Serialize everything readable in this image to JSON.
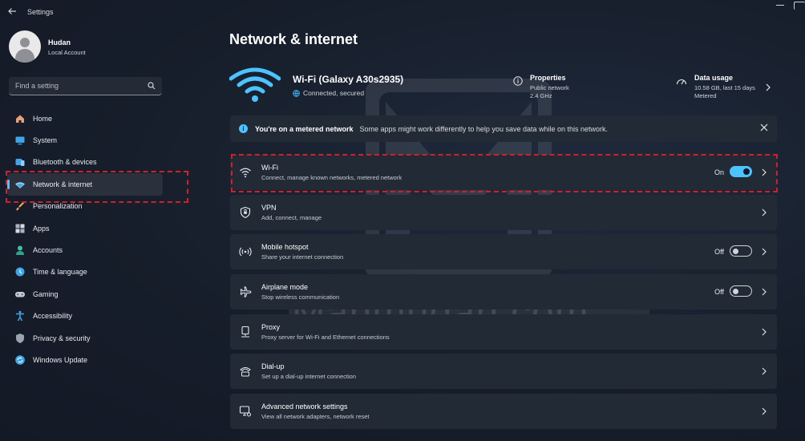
{
  "window": {
    "title": "Settings"
  },
  "profile": {
    "name": "Hudan",
    "account_type": "Local Account"
  },
  "search": {
    "placeholder": "Find a setting"
  },
  "sidebar": {
    "items": [
      {
        "label": "Home",
        "icon": "home-icon"
      },
      {
        "label": "System",
        "icon": "system-icon"
      },
      {
        "label": "Bluetooth & devices",
        "icon": "bluetooth-icon"
      },
      {
        "label": "Network & internet",
        "icon": "network-icon",
        "active": true
      },
      {
        "label": "Personalization",
        "icon": "brush-icon"
      },
      {
        "label": "Apps",
        "icon": "apps-icon"
      },
      {
        "label": "Accounts",
        "icon": "accounts-icon"
      },
      {
        "label": "Time & language",
        "icon": "time-language-icon"
      },
      {
        "label": "Gaming",
        "icon": "gaming-icon"
      },
      {
        "label": "Accessibility",
        "icon": "accessibility-icon"
      },
      {
        "label": "Privacy & security",
        "icon": "shield-icon"
      },
      {
        "label": "Windows Update",
        "icon": "update-icon"
      }
    ]
  },
  "page": {
    "title": "Network & internet"
  },
  "connection": {
    "name": "Wi-Fi (Galaxy A30s2935)",
    "status": "Connected, secured",
    "properties": {
      "title": "Properties",
      "line1": "Public network",
      "line2": "2.4 GHz"
    },
    "data_usage": {
      "title": "Data usage",
      "line1": "10.58 GB, last 15 days",
      "line2": "Metered"
    }
  },
  "infobar": {
    "title": "You're on a metered network",
    "message": "Some apps might work differently to help you save data while on this network."
  },
  "cards": [
    {
      "title": "Wi-Fi",
      "subtitle": "Connect, manage known networks, metered network",
      "state": "On",
      "toggle": true,
      "toggle_on": true,
      "icon": "wifi-icon"
    },
    {
      "title": "VPN",
      "subtitle": "Add, connect, manage",
      "icon": "vpn-shield-icon"
    },
    {
      "title": "Mobile hotspot",
      "subtitle": "Share your internet connection",
      "state": "Off",
      "toggle": true,
      "toggle_on": false,
      "icon": "hotspot-icon"
    },
    {
      "title": "Airplane mode",
      "subtitle": "Stop wireless communication",
      "state": "Off",
      "toggle": true,
      "toggle_on": false,
      "icon": "airplane-icon"
    },
    {
      "title": "Proxy",
      "subtitle": "Proxy server for Wi-Fi and Ethernet connections",
      "icon": "proxy-icon"
    },
    {
      "title": "Dial-up",
      "subtitle": "Set up a dial-up internet connection",
      "icon": "dialup-icon"
    },
    {
      "title": "Advanced network settings",
      "subtitle": "View all network adapters, network reset",
      "icon": "advanced-network-icon"
    }
  ],
  "watermark": {
    "text": "Mahmudan.com"
  },
  "colors": {
    "accent": "#4cc2ff",
    "highlight": "#d21f2a",
    "card": "#222a36"
  }
}
